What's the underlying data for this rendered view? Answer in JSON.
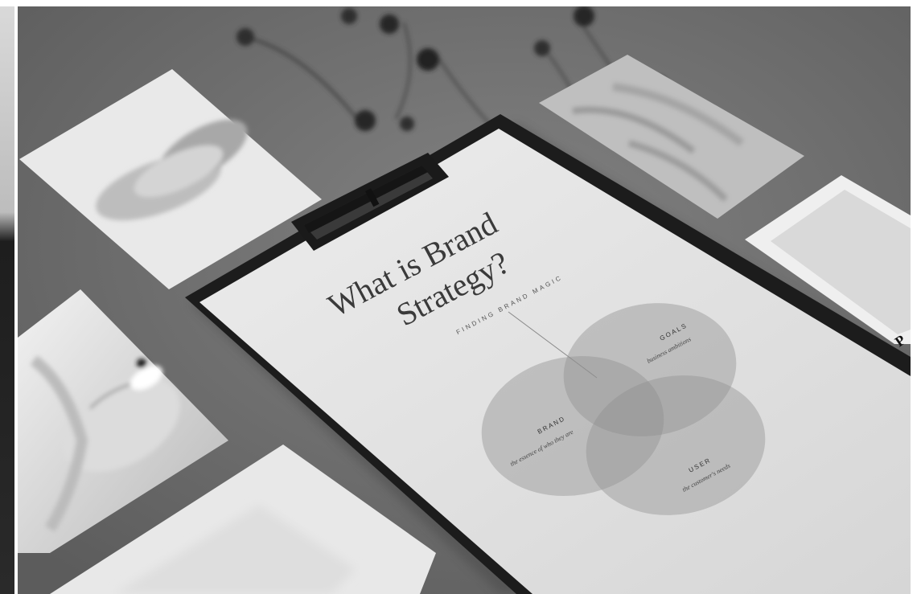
{
  "photo": {
    "subject": "flat-lay",
    "tone": "grayscale",
    "clipboard": {
      "title_line1": "What is Brand",
      "title_line2": "Strategy?",
      "subtitle": "FINDING BRAND MAGIC"
    },
    "venn": {
      "brand_label": "BRAND",
      "brand_sub": "the essence of who they are",
      "goals_label": "GOALS",
      "goals_sub": "business ambitions",
      "user_label": "USER",
      "user_sub": "the customer's needs"
    },
    "card_fragment": "P"
  },
  "colors": {
    "table": "#6e6e6e",
    "paper": "#e6e6e6",
    "clipboard_board": "#1c1c1c",
    "circle_fill": "#9a9a9a"
  }
}
